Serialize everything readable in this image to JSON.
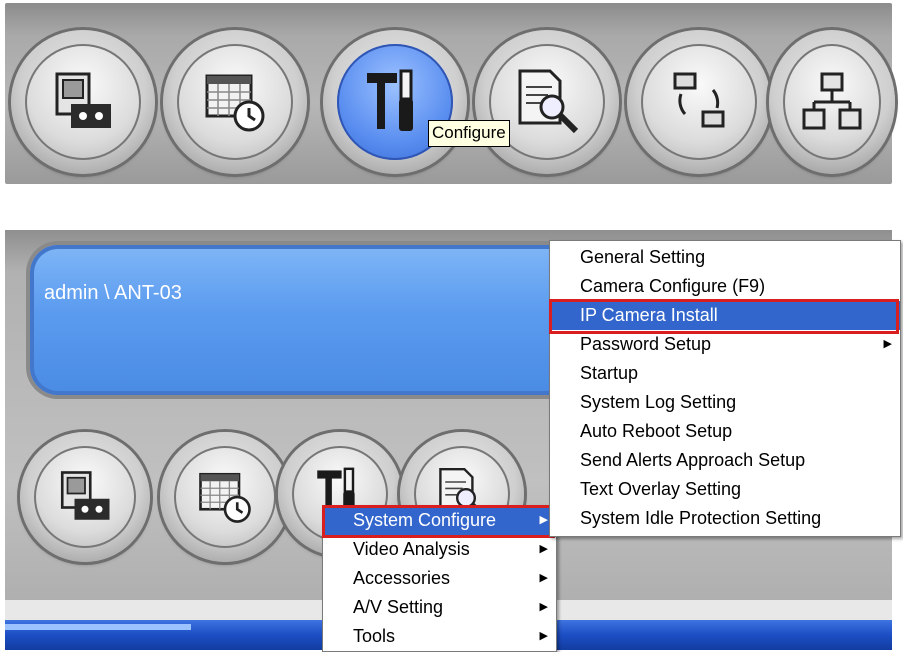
{
  "top_toolbar": {
    "tooltip": "Configure",
    "buttons": [
      "playback-icon",
      "schedule-icon",
      "configure-icon",
      "search-icon",
      "backup-icon",
      "network-icon"
    ]
  },
  "display": {
    "user_label": "admin \\ ANT-03"
  },
  "context_menu": {
    "items": [
      {
        "label": "System Configure",
        "submenu": true
      },
      {
        "label": "Video Analysis",
        "submenu": true
      },
      {
        "label": "Accessories",
        "submenu": true
      },
      {
        "label": "A/V Setting",
        "submenu": true
      },
      {
        "label": "Tools",
        "submenu": true
      }
    ]
  },
  "submenu": {
    "items": [
      {
        "label": "General Setting"
      },
      {
        "label": "Camera Configure (F9)"
      },
      {
        "label": "IP Camera Install"
      },
      {
        "label": "Password Setup",
        "submenu": true
      },
      {
        "label": "Startup"
      },
      {
        "label": "System Log Setting"
      },
      {
        "label": "Auto Reboot Setup"
      },
      {
        "label": "Send Alerts Approach Setup"
      },
      {
        "label": "Text Overlay Setting"
      },
      {
        "label": "System Idle Protection Setting"
      }
    ]
  },
  "colors": {
    "highlight": "#3366cc",
    "annotation": "#d81e1e",
    "display_blue": "#5b9bef"
  }
}
